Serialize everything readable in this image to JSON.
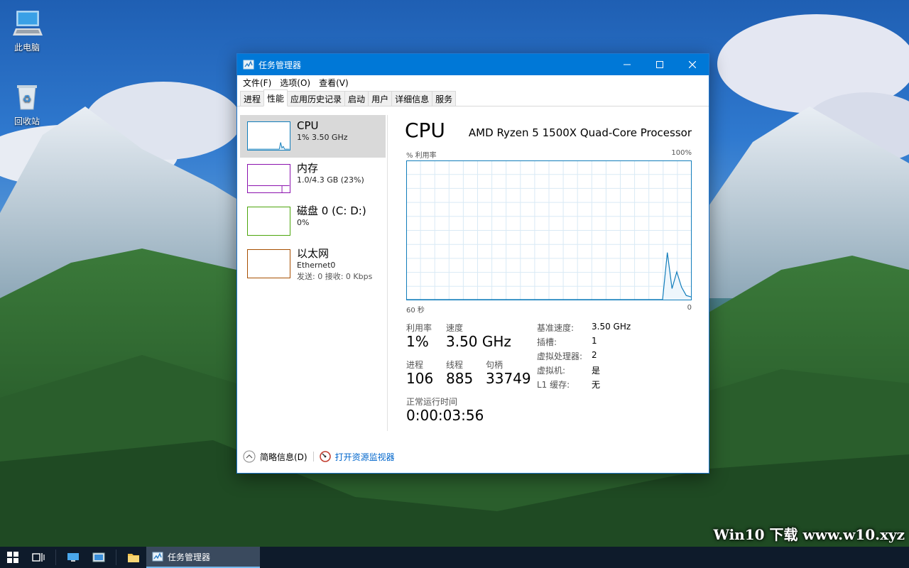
{
  "desktop": {
    "icons": [
      {
        "label": "此电脑",
        "icon": "this-pc-icon"
      },
      {
        "label": "回收站",
        "icon": "recycle-bin-icon"
      }
    ],
    "watermark": "Win10 下载 www.w10.xyz"
  },
  "taskbar": {
    "active_app_label": "任务管理器"
  },
  "window": {
    "title": "任务管理器",
    "menu": [
      "文件(F)",
      "选项(O)",
      "查看(V)"
    ],
    "tabs": [
      "进程",
      "性能",
      "应用历史记录",
      "启动",
      "用户",
      "详细信息",
      "服务"
    ],
    "active_tab": "性能"
  },
  "perf_list": [
    {
      "name": "CPU",
      "sub": "1% 3.50 GHz",
      "sub2": "",
      "color": "#117dbb",
      "selected": true
    },
    {
      "name": "内存",
      "sub": "1.0/4.3 GB (23%)",
      "sub2": "",
      "color": "#8b12ae",
      "selected": false
    },
    {
      "name": "磁盘 0 (C: D:)",
      "sub": "0%",
      "sub2": "",
      "color": "#4da60c",
      "selected": false
    },
    {
      "name": "以太网",
      "sub": "Ethernet0",
      "sub2": "发送: 0 接收: 0 Kbps",
      "color": "#a74f01",
      "selected": false
    }
  ],
  "detail": {
    "title": "CPU",
    "model": "AMD Ryzen 5 1500X Quad-Core Processor",
    "y_label": "% 利用率",
    "y_max_label": "100%",
    "x_left_label": "60 秒",
    "x_right_label": "0",
    "stats": {
      "utilization_label": "利用率",
      "utilization": "1%",
      "speed_label": "速度",
      "speed": "3.50 GHz",
      "processes_label": "进程",
      "processes": "106",
      "threads_label": "线程",
      "threads": "885",
      "handles_label": "句柄",
      "handles": "33749",
      "uptime_label": "正常运行时间",
      "uptime": "0:00:03:56"
    },
    "specs": [
      {
        "key": "基准速度:",
        "value": "3.50 GHz"
      },
      {
        "key": "插槽:",
        "value": "1"
      },
      {
        "key": "虚拟处理器:",
        "value": "2"
      },
      {
        "key": "虚拟机:",
        "value": "是"
      },
      {
        "key": "L1 缓存:",
        "value": "无"
      }
    ]
  },
  "chart_data": {
    "type": "area",
    "x": [
      60,
      59,
      58,
      57,
      56,
      55,
      54,
      53,
      52,
      51,
      50,
      49,
      48,
      47,
      46,
      45,
      44,
      43,
      42,
      41,
      40,
      39,
      38,
      37,
      36,
      35,
      34,
      33,
      32,
      31,
      30,
      29,
      28,
      27,
      26,
      25,
      24,
      23,
      22,
      21,
      20,
      19,
      18,
      17,
      16,
      15,
      14,
      13,
      12,
      11,
      10,
      9,
      8,
      7,
      6,
      5,
      4,
      3,
      2,
      1,
      0
    ],
    "values": [
      0,
      0,
      0,
      0,
      0,
      0,
      0,
      0,
      0,
      0,
      0,
      0,
      0,
      0,
      0,
      0,
      0,
      0,
      0,
      0,
      0,
      0,
      0,
      0,
      0,
      0,
      0,
      0,
      0,
      0,
      0,
      0,
      0,
      0,
      0,
      0,
      0,
      0,
      0,
      0,
      0,
      0,
      0,
      0,
      0,
      0,
      0,
      0,
      0,
      0,
      0,
      0,
      0,
      0,
      0,
      34,
      8,
      20,
      9,
      3,
      2
    ],
    "xlabel": "",
    "ylabel": "% 利用率",
    "xlim": [
      60,
      0
    ],
    "ylim": [
      0,
      100
    ],
    "grid": true,
    "color": "#117dbb"
  },
  "footer": {
    "collapse_label": "简略信息(D)",
    "monitor_link": "打开资源监视器"
  }
}
